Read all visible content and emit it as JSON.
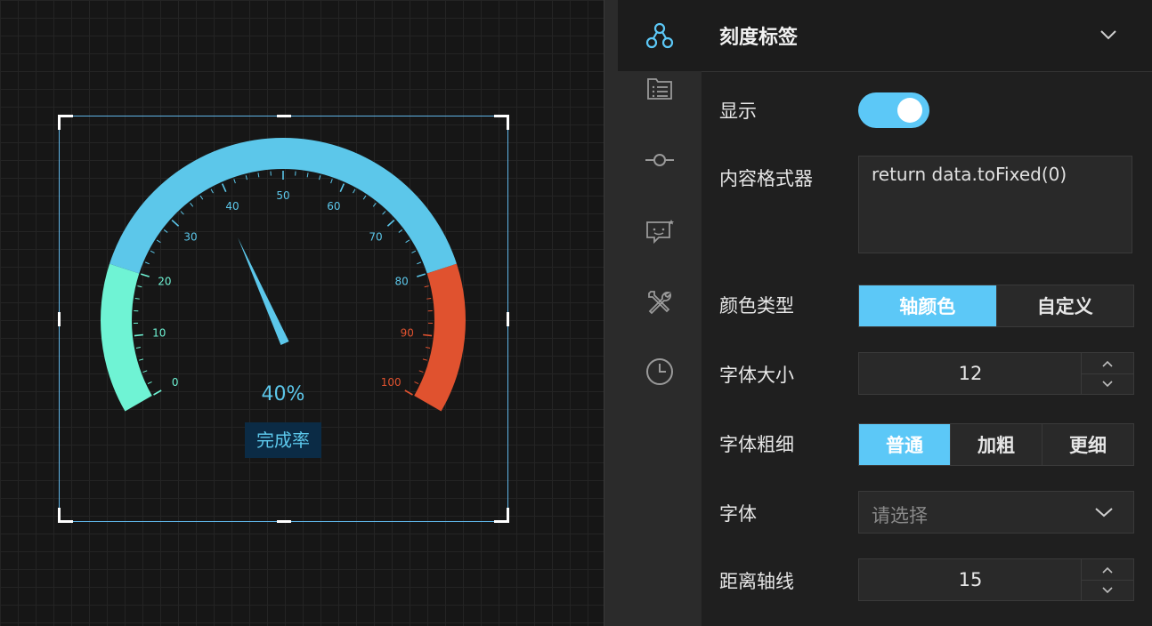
{
  "gauge": {
    "min": 0,
    "max": 100,
    "value": 40,
    "tick_labels": [
      "0",
      "10",
      "20",
      "30",
      "40",
      "50",
      "60",
      "70",
      "80",
      "90",
      "100"
    ],
    "value_label": "40%",
    "name_label": "完成率",
    "colors": {
      "low": "#6ff3d4",
      "mid": "#5cc7ea",
      "high": "#e0522f",
      "pointer": "#5cc7ea",
      "name_bg": "#0b2b45"
    },
    "segments": [
      {
        "from": 0,
        "to": 20,
        "color_key": "low"
      },
      {
        "from": 20,
        "to": 80,
        "color_key": "mid"
      },
      {
        "from": 80,
        "to": 100,
        "color_key": "high"
      }
    ]
  },
  "rail": {
    "items": [
      {
        "icon": "tree-nodes-icon",
        "active": true
      },
      {
        "icon": "list-icon",
        "active": false
      },
      {
        "icon": "commit-icon",
        "active": false
      },
      {
        "icon": "tooltip-icon",
        "active": false
      },
      {
        "icon": "tools-icon",
        "active": false
      },
      {
        "icon": "clock-icon",
        "active": false
      }
    ]
  },
  "panel": {
    "title": "刻度标签",
    "show_label": "显示",
    "show_on": true,
    "formatter_label": "内容格式器",
    "formatter_value": "return data.toFixed(0)",
    "color_type_label": "颜色类型",
    "color_type_options": [
      "轴颜色",
      "自定义"
    ],
    "color_type_selected": 0,
    "font_size_label": "字体大小",
    "font_size_value": "12",
    "font_weight_label": "字体粗细",
    "font_weight_options": [
      "普通",
      "加粗",
      "更细"
    ],
    "font_weight_selected": 0,
    "font_label": "字体",
    "font_placeholder": "请选择",
    "distance_label": "距离轴线",
    "distance_value": "15",
    "accent": "#5cc8f7"
  }
}
